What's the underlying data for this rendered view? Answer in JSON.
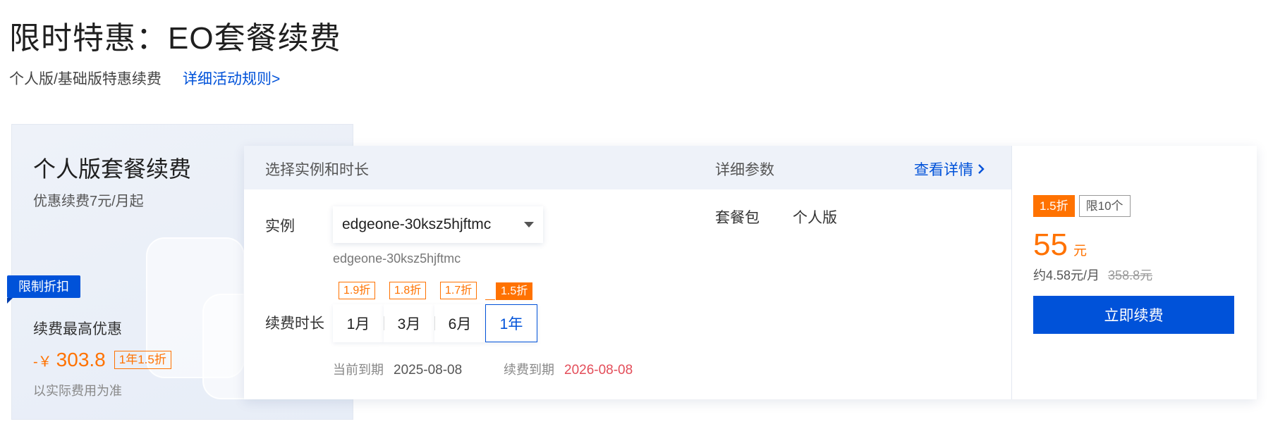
{
  "page": {
    "title": "限时特惠：EO套餐续费",
    "subtitle": "个人版/基础版特惠续费",
    "rules_link": "详细活动规则>"
  },
  "promo": {
    "title": "个人版套餐续费",
    "subtitle": "优惠续费7元/月起",
    "ribbon": "限制折扣",
    "max_discount_label": "续费最高优惠",
    "price_prefix": "-￥",
    "price_amount": "303.8",
    "price_tag": "1年1.5折",
    "note": "以实际费用为准"
  },
  "selector": {
    "header": "选择实例和时长",
    "instance_label": "实例",
    "instance_value": "edgeone-30ksz5hjftmc",
    "instance_sub": "edgeone-30ksz5hjftmc",
    "duration_label": "续费时长",
    "durations": [
      {
        "label": "1月",
        "badge": "1.9折",
        "selected": false
      },
      {
        "label": "3月",
        "badge": "1.8折",
        "selected": false
      },
      {
        "label": "6月",
        "badge": "1.7折",
        "selected": false
      },
      {
        "label": "1年",
        "badge": "1.5折",
        "selected": true
      }
    ],
    "current_expiry_label": "当前到期",
    "current_expiry": "2025-08-08",
    "renew_expiry_label": "续费到期",
    "renew_expiry": "2026-08-08"
  },
  "details": {
    "header": "详细参数",
    "view_link": "查看详情",
    "package_label": "套餐包",
    "package_value": "个人版"
  },
  "summary": {
    "discount_tag": "1.5折",
    "limit_tag": "限10个",
    "price": "55",
    "unit": "元",
    "monthly": "约4.58元/月",
    "original": "358.8元",
    "buy_button": "立即续费"
  },
  "colors": {
    "accent_blue": "#0052d9",
    "accent_orange": "#ff7200",
    "expiry_red": "#e34d59"
  }
}
